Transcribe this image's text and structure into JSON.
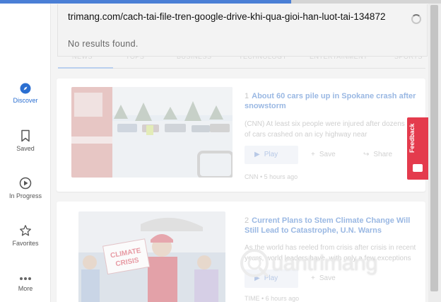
{
  "search": {
    "query": "trimang.com/cach-tai-file-tren-google-drive-khi-qua-gioi-han-luot-tai-134872",
    "status": "No results found."
  },
  "sidebar": {
    "items": [
      {
        "label": "Discover",
        "icon": "compass-icon",
        "active": true
      },
      {
        "label": "Saved",
        "icon": "bookmark-icon"
      },
      {
        "label": "In Progress",
        "icon": "play-circle-icon"
      },
      {
        "label": "Favorites",
        "icon": "star-icon"
      },
      {
        "label": "More",
        "icon": "more-dots-icon"
      }
    ]
  },
  "tabs": [
    "NEWS",
    "TOPS",
    "BUSINESS",
    "TECHNOLOGY",
    "ENTERTAINMENT",
    "SPORTS"
  ],
  "articles": [
    {
      "number": "1",
      "title": "About 60 cars pile up in Spokane crash after snowstorm",
      "summary": "(CNN) At least six people were injured after dozens of cars crashed on an icy highway near",
      "play_label": "Play",
      "save_label": "Save",
      "share_label": "Share",
      "source": "CNN",
      "time": "5 hours ago"
    },
    {
      "number": "2",
      "title": "Current Plans to Stem Climate Change Will Still Lead to Catastrophe, U.N. Warns",
      "summary": "As the world has reeled from crisis after crisis in recent years, world leaders have, with only a few exceptions",
      "play_label": "Play",
      "save_label": "Save",
      "source": "TIME",
      "time": "6 hours ago",
      "sign_text": "CLIMATE CRISIS"
    }
  ],
  "feedback": {
    "label": "Feedback"
  },
  "watermark": {
    "text": "uantrimang"
  },
  "colors": {
    "accent": "#2b6fd1",
    "feedback": "#e43b4d",
    "topbar": "#4a7fd6"
  }
}
